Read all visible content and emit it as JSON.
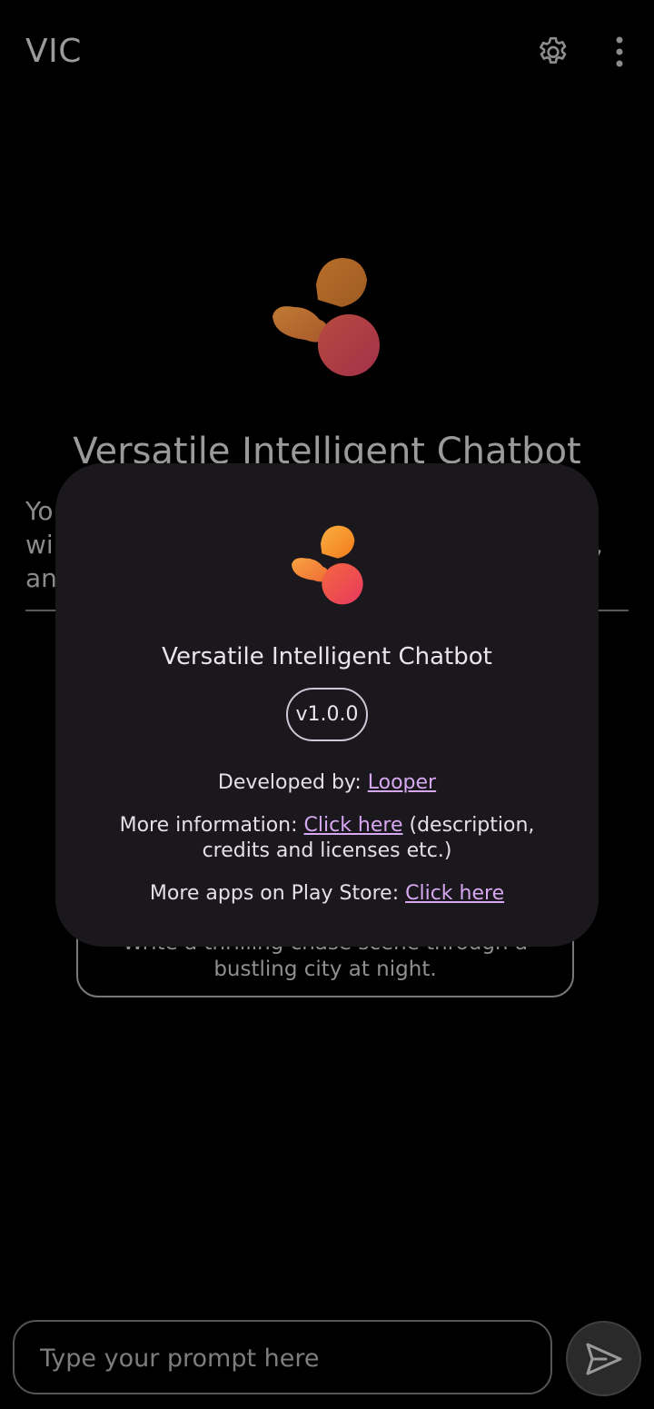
{
  "header": {
    "title": "VIC",
    "settings_icon": "gear-icon",
    "more_icon": "more-vertical-icon"
  },
  "main": {
    "title": "Versatile Intelligent Chatbot",
    "description_fragments": [
      "Yo",
      "wi",
      "an",
      ","
    ],
    "suggestion": "Write a thrilling chase scene through a bustling city at night."
  },
  "input": {
    "placeholder": "Type your prompt here",
    "send_icon": "send-icon"
  },
  "dialog": {
    "title": "Versatile Intelligent Chatbot",
    "version": "v1.0.0",
    "developed_label": "Developed by: ",
    "developer_link": "Looper",
    "info_label": "More information: ",
    "info_link": "Click here",
    "info_suffix": " (description, credits and licenses etc.)",
    "apps_label": "More apps on Play Store: ",
    "apps_link": "Click here"
  },
  "colors": {
    "background": "#000000",
    "dialog_bg": "#1a171d",
    "link": "#d7a8f2",
    "logo_orange": "#f5a23a",
    "logo_pink": "#e8425e"
  }
}
